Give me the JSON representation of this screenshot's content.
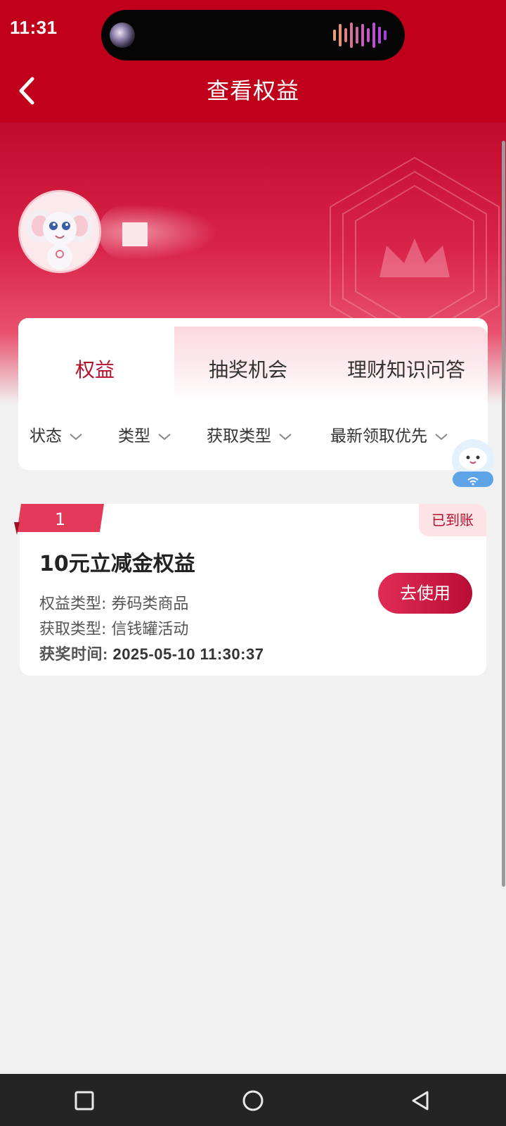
{
  "status_bar": {
    "time": "11:31"
  },
  "nav": {
    "title": "查看权益"
  },
  "tabs": [
    {
      "label": "权益",
      "active": true
    },
    {
      "label": "抽奖机会",
      "active": false
    },
    {
      "label": "理财知识问答",
      "active": false
    }
  ],
  "filters": [
    {
      "label": "状态"
    },
    {
      "label": "类型"
    },
    {
      "label": "获取类型"
    },
    {
      "label": "最新领取优先"
    }
  ],
  "rewards": [
    {
      "rank": "1",
      "status": "已到账",
      "title": "10元立减金权益",
      "type_label": "权益类型:",
      "type_value": "券码类商品",
      "source_label": "获取类型:",
      "source_value": "信钱罐活动",
      "time_label": "获奖时间:",
      "time_value": "2025-05-10 11:30:37",
      "action": "去使用"
    }
  ],
  "colors": {
    "brand_red": "#c0001a",
    "accent_text": "#b5102c",
    "status_bg": "#fde3e6",
    "page_bg": "#f1f1f1"
  },
  "icons": {
    "back": "chevron-left-icon",
    "filter_chevron": "chevron-down-icon",
    "assistant": "cloud-assistant-icon",
    "sys_recent": "square-icon",
    "sys_home": "circle-icon",
    "sys_back": "triangle-back-icon"
  }
}
